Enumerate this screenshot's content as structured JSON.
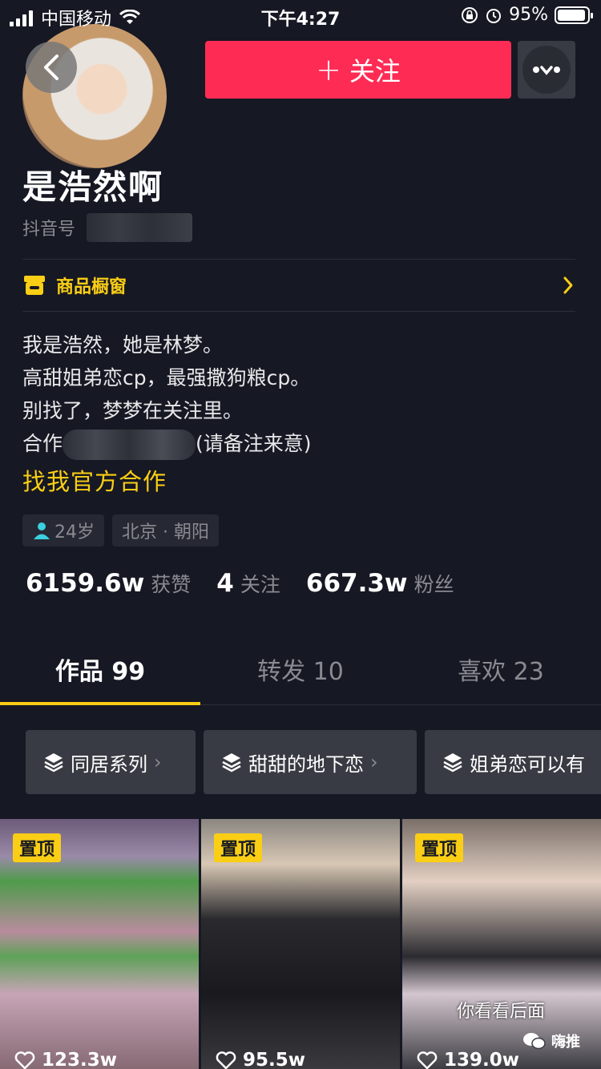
{
  "status_bar": {
    "carrier": "中国移动",
    "time": "下午4:27",
    "battery": "95%",
    "battery_level": 0.95
  },
  "header": {
    "follow_label": "关注",
    "follow_plus": "+"
  },
  "profile": {
    "nickname": "是浩然啊",
    "douyin_id_label": "抖音号"
  },
  "shop": {
    "label": "商品橱窗"
  },
  "bio": {
    "line1": "我是浩然，她是林梦。",
    "line2": "高甜姐弟恋cp，最强撒狗粮cp。",
    "line3": "别找了，梦梦在关注里。",
    "line4_prefix": "合作",
    "line4_suffix": "(请备注来意)",
    "official_link": "找我官方合作"
  },
  "tags": {
    "age": "24岁",
    "location": "北京 · 朝阳"
  },
  "stats": {
    "likes_num": "6159.6w",
    "likes_label": "获赞",
    "following_num": "4",
    "following_label": "关注",
    "fans_num": "667.3w",
    "fans_label": "粉丝"
  },
  "tabs": [
    {
      "label": "作品 99"
    },
    {
      "label": "转发 10"
    },
    {
      "label": "喜欢 23"
    }
  ],
  "collections": [
    {
      "label": "同居系列"
    },
    {
      "label": "甜甜的地下恋"
    },
    {
      "label": "姐弟恋可以有"
    }
  ],
  "videos": [
    {
      "pin": "置顶",
      "likes": "123.3w"
    },
    {
      "pin": "置顶",
      "likes": "95.5w"
    },
    {
      "pin": "置顶",
      "likes": "139.0w",
      "subtitle": "你看看后面"
    }
  ],
  "watermark": "嗨推",
  "colors": {
    "background": "#161823",
    "accent_red": "#fe2c55",
    "accent_yellow": "#face15"
  }
}
